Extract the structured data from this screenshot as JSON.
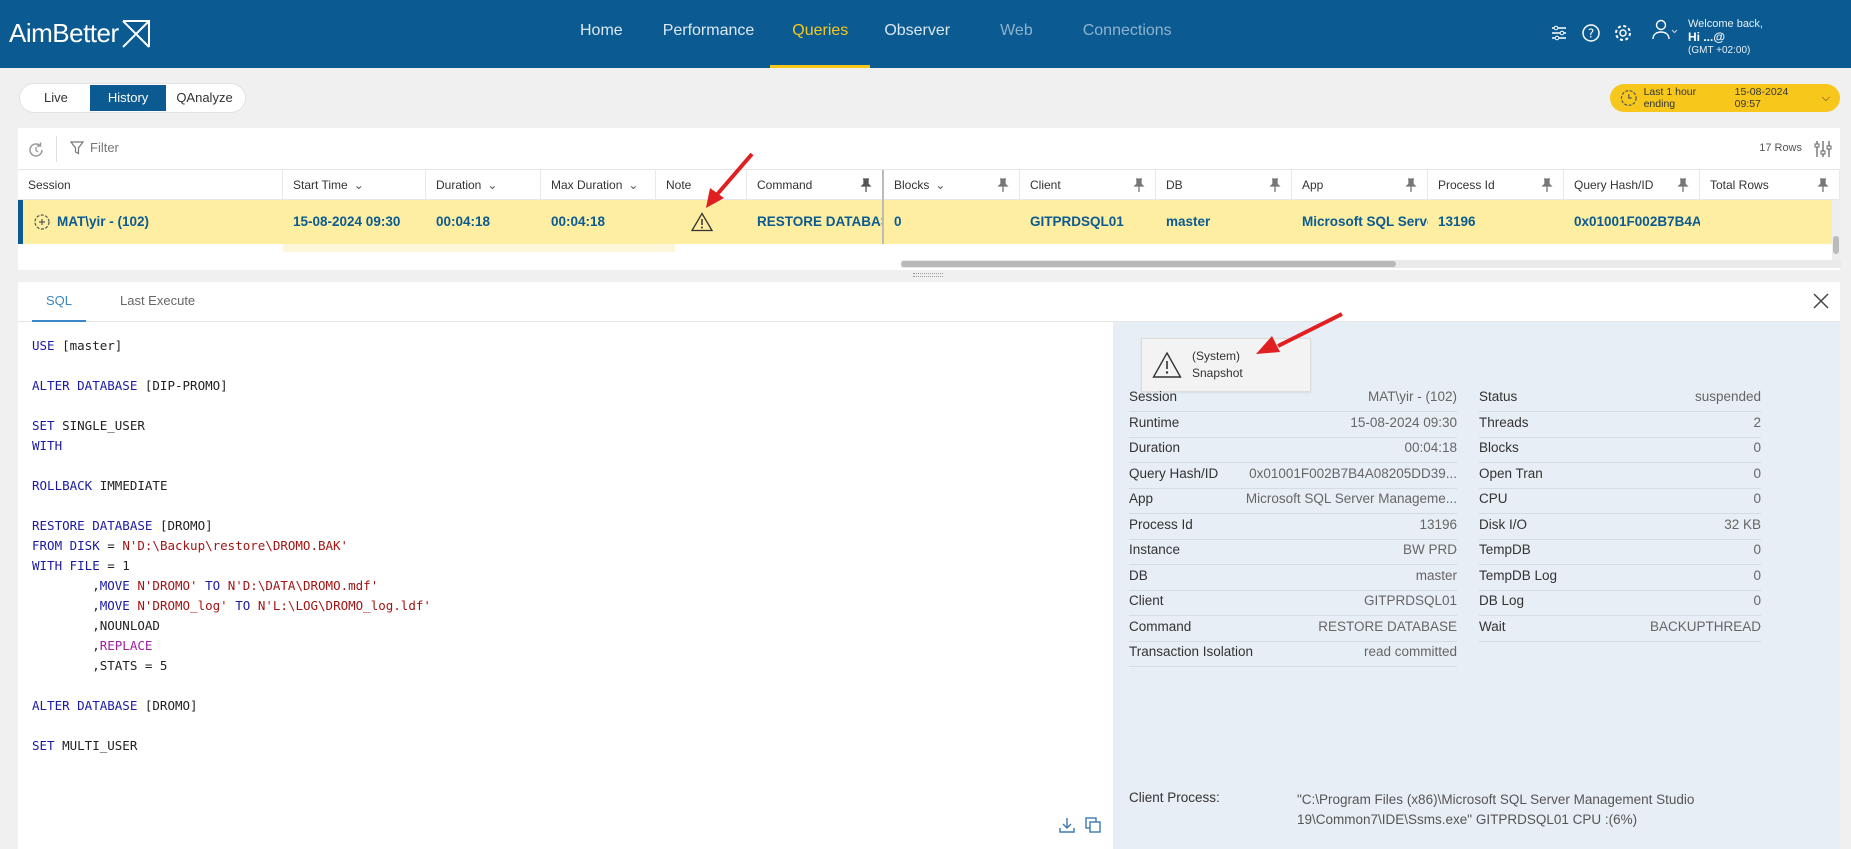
{
  "app": {
    "logo_text": "AimBetter"
  },
  "nav": {
    "items": [
      {
        "label": "Home"
      },
      {
        "label": "Performance"
      },
      {
        "label": "Queries"
      },
      {
        "label": "Observer"
      },
      {
        "label": "Web"
      },
      {
        "label": "Connections"
      }
    ]
  },
  "user": {
    "welcome": "Welcome back,",
    "name": "Hi ...@",
    "tz": "(GMT +02:00)"
  },
  "modes": [
    {
      "label": "Live"
    },
    {
      "label": "History"
    },
    {
      "label": "QAnalyze"
    }
  ],
  "time_range": {
    "label": "Last 1 hour ending",
    "value": "15-08-2024 09:57"
  },
  "toolbar": {
    "filter_placeholder": "Filter",
    "rows_count": "17 Rows"
  },
  "grid": {
    "columns": [
      {
        "label": "Session"
      },
      {
        "label": "Start Time"
      },
      {
        "label": "Duration"
      },
      {
        "label": "Max Duration"
      },
      {
        "label": "Note"
      },
      {
        "label": "Command"
      },
      {
        "label": "Blocks"
      },
      {
        "label": "Client"
      },
      {
        "label": "DB"
      },
      {
        "label": "App"
      },
      {
        "label": "Process Id"
      },
      {
        "label": "Query Hash/ID"
      },
      {
        "label": "Total Rows"
      }
    ],
    "row": {
      "session": "MAT\\yir - (102)",
      "start_time": "15-08-2024 09:30",
      "duration": "00:04:18",
      "max_duration": "00:04:18",
      "command": "RESTORE DATABAS",
      "blocks": "0",
      "client": "GITPRDSQL01",
      "db": "master",
      "app": "Microsoft SQL Serve",
      "process_id": "13196",
      "query_hash": "0x01001F002B7B4A"
    }
  },
  "detail": {
    "tabs": [
      {
        "label": "SQL"
      },
      {
        "label": "Last Execute"
      }
    ],
    "snapshot": {
      "line1": "(System)",
      "line2": "Snapshot"
    },
    "left_fields": [
      {
        "k": "Session",
        "v": "MAT\\yir - (102)"
      },
      {
        "k": "Runtime",
        "v": "15-08-2024 09:30"
      },
      {
        "k": "Duration",
        "v": "00:04:18"
      },
      {
        "k": "Query Hash/ID",
        "v": "0x01001F002B7B4A08205DD39..."
      },
      {
        "k": "App",
        "v": "Microsoft SQL Server Manageme..."
      },
      {
        "k": "Process Id",
        "v": "13196"
      },
      {
        "k": "Instance",
        "v": "BW PRD"
      },
      {
        "k": "DB",
        "v": "master"
      },
      {
        "k": "Client",
        "v": "GITPRDSQL01"
      },
      {
        "k": "Command",
        "v": "RESTORE DATABASE"
      },
      {
        "k": "Transaction Isolation",
        "v": "read committed"
      }
    ],
    "right_fields": [
      {
        "k": "Status",
        "v": "suspended"
      },
      {
        "k": "Threads",
        "v": "2"
      },
      {
        "k": "Blocks",
        "v": "0"
      },
      {
        "k": "Open Tran",
        "v": "0"
      },
      {
        "k": "CPU",
        "v": "0"
      },
      {
        "k": "Disk I/O",
        "v": "32 KB"
      },
      {
        "k": "TempDB",
        "v": "0"
      },
      {
        "k": "TempDB Log",
        "v": "0"
      },
      {
        "k": "DB Log",
        "v": "0"
      },
      {
        "k": "Wait",
        "v": "BACKUPTHREAD"
      }
    ],
    "client_process": {
      "k": "Client Process:",
      "v": "\"C:\\Program Files (x86)\\Microsoft SQL Server Management Studio 19\\Common7\\IDE\\Ssms.exe\" GITPRDSQL01 CPU :(6%)"
    }
  },
  "sql_lines": [
    [
      {
        "t": "kw",
        "s": "USE"
      },
      {
        "t": "n",
        "s": " [master]"
      }
    ],
    [],
    [
      {
        "t": "kw",
        "s": "ALTER DATABASE"
      },
      {
        "t": "n",
        "s": " [DIP-PROMO]"
      }
    ],
    [],
    [
      {
        "t": "kw",
        "s": "SET"
      },
      {
        "t": "n",
        "s": " SINGLE_USER"
      }
    ],
    [
      {
        "t": "kw",
        "s": "WITH"
      }
    ],
    [],
    [
      {
        "t": "kw",
        "s": "ROLLBACK"
      },
      {
        "t": "n",
        "s": " IMMEDIATE"
      }
    ],
    [],
    [
      {
        "t": "kw",
        "s": "RESTORE DATABASE"
      },
      {
        "t": "n",
        "s": " [DROMO]"
      }
    ],
    [
      {
        "t": "kw",
        "s": "FROM DISK"
      },
      {
        "t": "n",
        "s": " = "
      },
      {
        "t": "str",
        "s": "N'D:\\Backup\\restore\\DROMO.BAK'"
      }
    ],
    [
      {
        "t": "kw",
        "s": "WITH FILE"
      },
      {
        "t": "n",
        "s": " = 1"
      }
    ],
    [
      {
        "t": "n",
        "s": "        ,"
      },
      {
        "t": "kw",
        "s": "MOVE"
      },
      {
        "t": "n",
        "s": " "
      },
      {
        "t": "str",
        "s": "N'DROMO'"
      },
      {
        "t": "n",
        "s": " "
      },
      {
        "t": "kw",
        "s": "TO"
      },
      {
        "t": "n",
        "s": " "
      },
      {
        "t": "str",
        "s": "N'D:\\DATA\\DROMO.mdf'"
      }
    ],
    [
      {
        "t": "n",
        "s": "        ,"
      },
      {
        "t": "kw",
        "s": "MOVE"
      },
      {
        "t": "n",
        "s": " "
      },
      {
        "t": "str",
        "s": "N'DROMO_log'"
      },
      {
        "t": "n",
        "s": " "
      },
      {
        "t": "kw",
        "s": "TO"
      },
      {
        "t": "n",
        "s": " "
      },
      {
        "t": "str",
        "s": "N'L:\\LOG\\DROMO_log.ldf'"
      }
    ],
    [
      {
        "t": "n",
        "s": "        ,NOUNLOAD"
      }
    ],
    [
      {
        "t": "n",
        "s": "        ,"
      },
      {
        "t": "mag",
        "s": "REPLACE"
      }
    ],
    [
      {
        "t": "n",
        "s": "        ,STATS = 5"
      }
    ],
    [],
    [
      {
        "t": "kw",
        "s": "ALTER DATABASE"
      },
      {
        "t": "n",
        "s": " [DROMO]"
      }
    ],
    [],
    [
      {
        "t": "kw",
        "s": "SET"
      },
      {
        "t": "n",
        "s": " MULTI_USER"
      }
    ]
  ],
  "colors": {
    "brand": "#0b5a91",
    "accent": "#f7c81b",
    "row_highlight": "#fdeea2",
    "arrow": "#e02020"
  }
}
